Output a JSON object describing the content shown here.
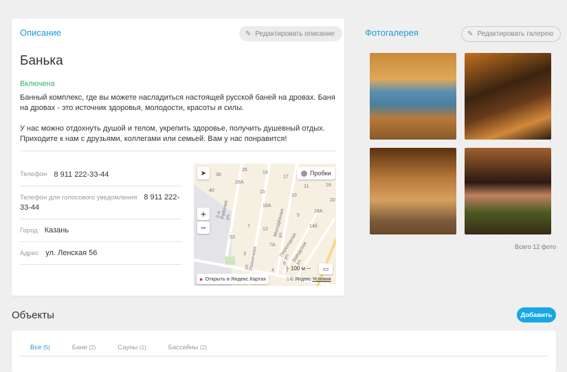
{
  "description": {
    "title": "Описание",
    "edit_label": "Редактировать описание",
    "name": "Банька",
    "status": "Включена",
    "status_color": "#2fb36b",
    "text1": "Банный комплекс, где вы можете насладиться настоящей русской баней на дровах. Баня на дровах - это источник здоровья, молодости, красоты и силы.",
    "text2": "У нас можно отдохнуть душой и телом, укрепить здоровье, получить душевный отдых. Приходите к нам с друзьями, коллегами или семьей. Вам у нас понравится!"
  },
  "contacts": [
    {
      "label": "Телефон",
      "value": "8 911 222-33-44"
    },
    {
      "label": "Телефон для голосового уведомления",
      "value": "8 911 222-33-44"
    },
    {
      "label": "Город",
      "value": "Казань"
    },
    {
      "label": "Адрес",
      "value": "ул. Ленская 56"
    }
  ],
  "map": {
    "traffic": "Пробки",
    "open_link": "Открыть в Яндекс.Картах",
    "scale": "100 м",
    "copyright": "© Яндекс",
    "terms": "Условия",
    "streets": [
      "2-я Рабочая ул.",
      "ул. Иваничева",
      "Молодёжная ул.",
      "Переходная ул.",
      "Заводская ул."
    ],
    "houses": [
      "36",
      "26",
      "19",
      "17",
      "28А",
      "40",
      "15",
      "10",
      "11",
      "18",
      "18А",
      "20",
      "5",
      "18А",
      "14б",
      "12",
      "7",
      "53",
      "7А",
      "3",
      "6",
      "4",
      "1"
    ]
  },
  "gallery": {
    "title": "Фотогалерея",
    "edit_label": "Редактировать галерею",
    "total": "Всего 12 фото"
  },
  "objects": {
    "title": "Объекты",
    "add_label": "Добавить",
    "accent": "#17a7e5",
    "tabs": [
      {
        "label": "Все",
        "count": "(5)"
      },
      {
        "label": "Бани",
        "count": "(2)"
      },
      {
        "label": "Сауны",
        "count": "(1)"
      },
      {
        "label": "Бассейны",
        "count": "(2)"
      }
    ]
  }
}
